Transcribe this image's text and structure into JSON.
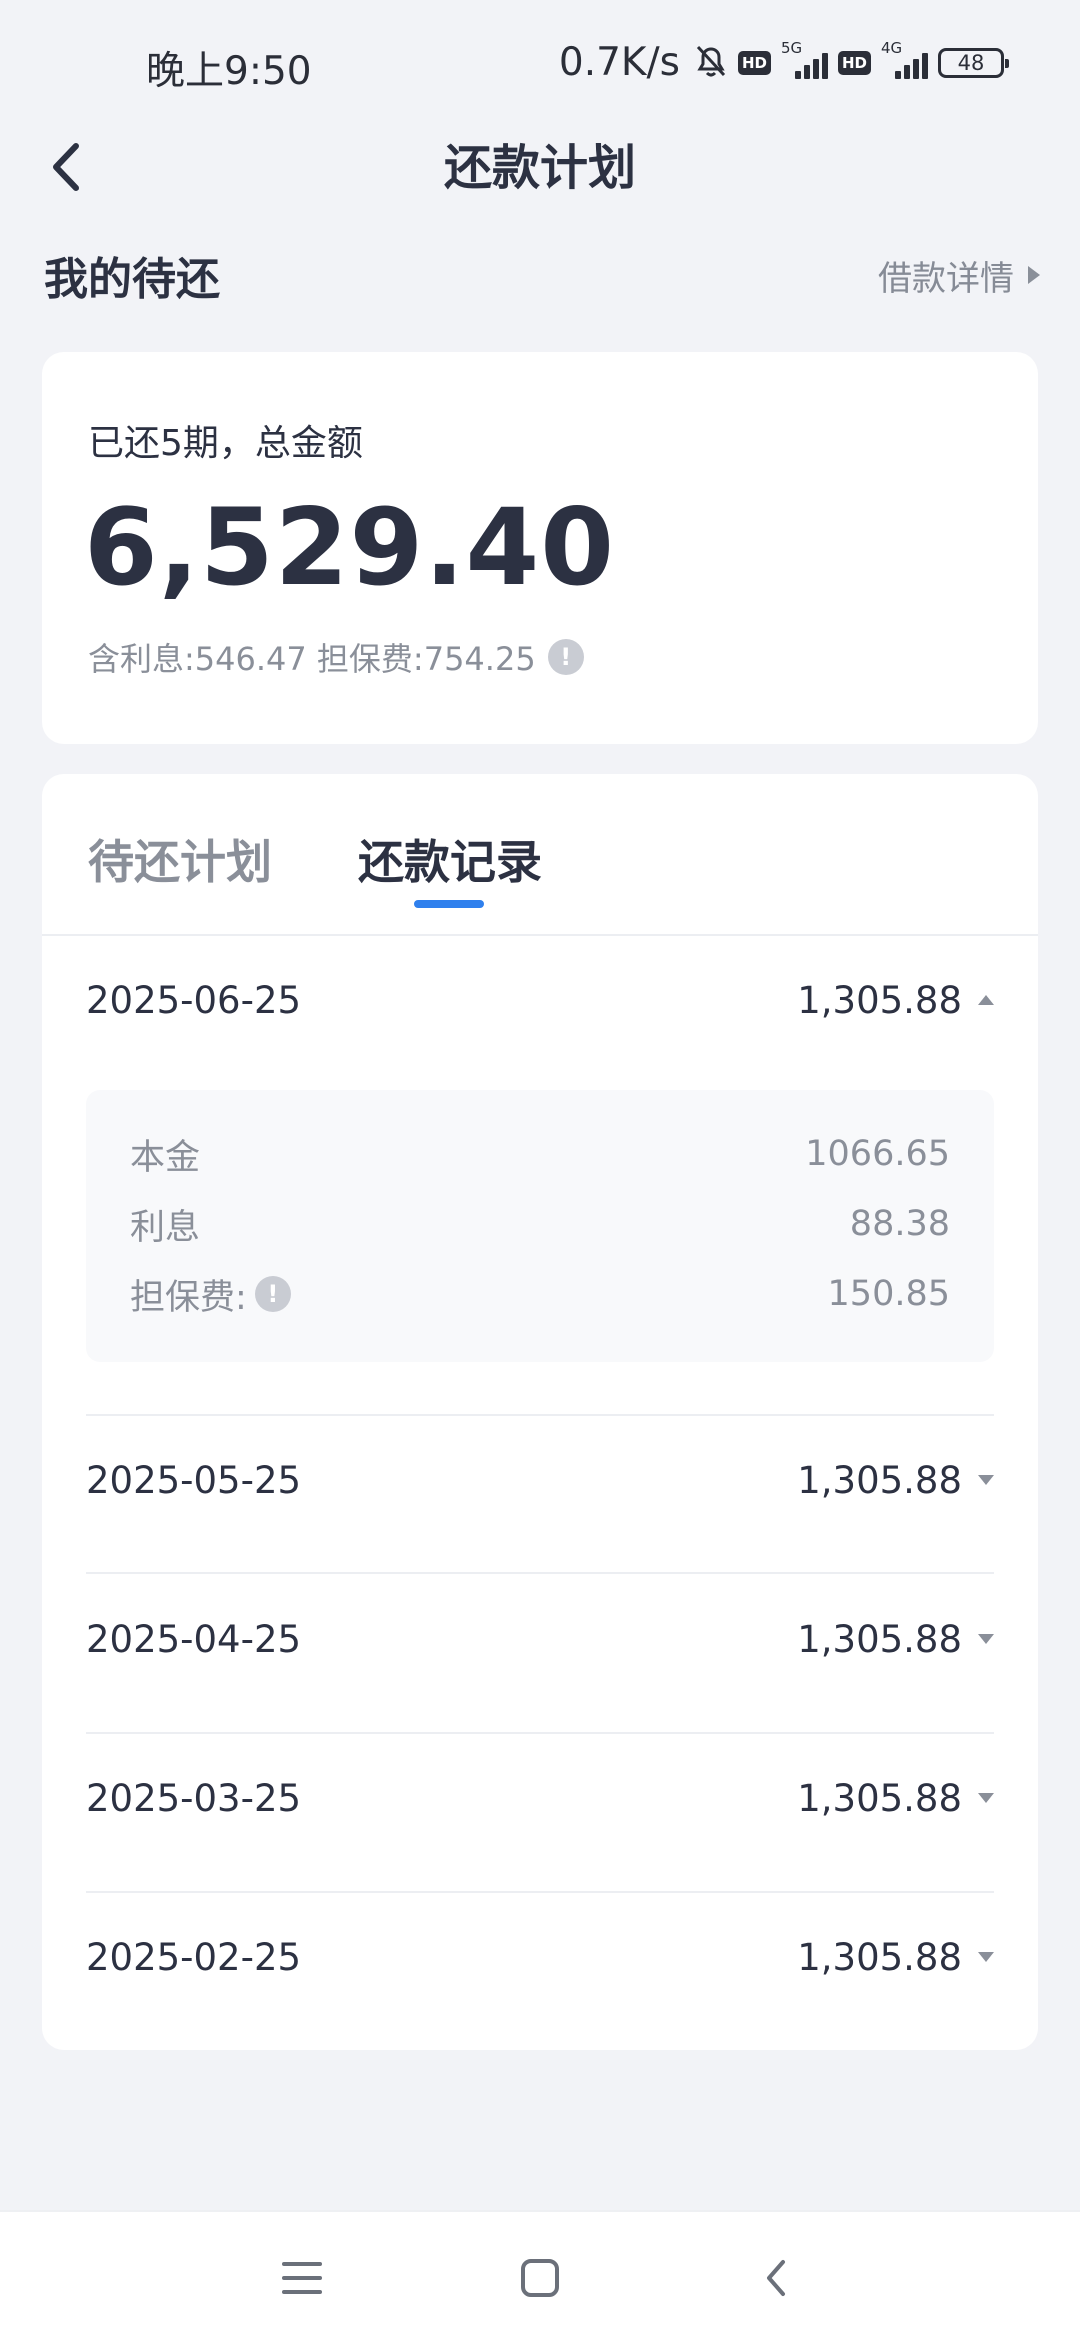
{
  "status_bar": {
    "time": "晚上9:50",
    "network_speed": "0.7K/s",
    "sim1": "5G",
    "sim2": "4G",
    "hd_label": "HD",
    "battery": "48"
  },
  "nav": {
    "title": "还款计划",
    "back_icon": "chevron-left-icon"
  },
  "section": {
    "title": "我的待还",
    "detail_link": "借款详情"
  },
  "summary": {
    "label": "已还5期，总金额",
    "total": "6,529.40",
    "sub": "含利息:546.47 担保费:754.25",
    "info_glyph": "!"
  },
  "tabs": [
    {
      "label": "待还计划",
      "active": false
    },
    {
      "label": "还款记录",
      "active": true
    }
  ],
  "records": [
    {
      "date": "2025-06-25",
      "amount": "1,305.88",
      "expanded": true,
      "breakdown": [
        {
          "label": "本金",
          "value": "1066.65"
        },
        {
          "label": "利息",
          "value": "88.38"
        },
        {
          "label": "担保费:",
          "value": "150.85"
        }
      ]
    },
    {
      "date": "2025-05-25",
      "amount": "1,305.88",
      "expanded": false
    },
    {
      "date": "2025-04-25",
      "amount": "1,305.88",
      "expanded": false
    },
    {
      "date": "2025-03-25",
      "amount": "1,305.88",
      "expanded": false
    },
    {
      "date": "2025-02-25",
      "amount": "1,305.88",
      "expanded": false
    }
  ],
  "colors": {
    "background": "#f2f3f7",
    "text_primary": "#2c3142",
    "text_secondary": "#8a8f99",
    "accent": "#2f80ed",
    "card": "#ffffff"
  },
  "bottom_nav": {
    "icons": [
      "menu-icon",
      "home-icon",
      "back-icon"
    ]
  }
}
